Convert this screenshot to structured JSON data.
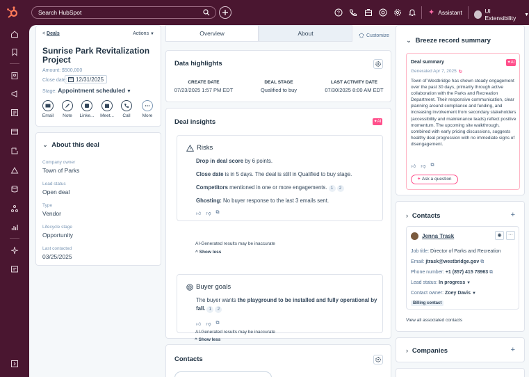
{
  "topbar": {
    "search_placeholder": "Search HubSpot",
    "assistant_label": "Assistant",
    "account_label": "UI Extensibility"
  },
  "record": {
    "back_label": "Deals",
    "actions_label": "Actions",
    "title": "Sunrise Park Revitalization Project",
    "amount": "Amount: $500,000",
    "close_date_label": "Close date:",
    "close_date": "12/31/2025",
    "stage_label": "Stage:",
    "stage": "Appointment scheduled",
    "actions": [
      "Email",
      "Note",
      "Linke...",
      "Meet...",
      "Call",
      "More"
    ]
  },
  "about": {
    "heading": "About this deal",
    "props": [
      {
        "label": "Company owner",
        "value": "Town of Parks"
      },
      {
        "label": "Lead status",
        "value": "Open deal"
      },
      {
        "label": "Type",
        "value": "Vendor"
      },
      {
        "label": "Lifecycle stage",
        "value": "Opportunity"
      },
      {
        "label": "Last contacted",
        "value": "03/25/2025"
      }
    ]
  },
  "tabs": {
    "overview": "Overview",
    "about": "About",
    "customize": "Customize"
  },
  "highlights": {
    "title": "Data highlights",
    "cols": [
      {
        "label": "CREATE DATE",
        "value": "07/23/2025 1:57 PM EDT"
      },
      {
        "label": "DEAL STAGE",
        "value": "Qualified to buy"
      },
      {
        "label": "LAST ACTIVITY DATE",
        "value": "07/30/2025 8:00 AM EDT"
      }
    ]
  },
  "insights": {
    "title": "Deal insights",
    "ai_badge": "AI",
    "risks": {
      "title": "Risks",
      "l1_b": "Drop in deal score",
      "l1_t": " by 6 points.",
      "l2_b": "Close date",
      "l2_t": " is in 5 days. The deal is still in Qualified to buy stage.",
      "l3_b": "Competitors",
      "l3_t": " mentioned in one or more engagements.",
      "l4_b": "Ghosting:",
      "l4_t": " No buyer response to the last 3 emails sent.",
      "refs": [
        "1",
        "2"
      ],
      "disclaimer": "AI-Generated results may be inaccurate",
      "show_less": "Show less"
    },
    "goals": {
      "title": "Buyer goals",
      "pre": "The buyer wants ",
      "bold": "the playground to be installed and fully operational by fall.",
      "refs": [
        "1",
        "2"
      ],
      "disclaimer": "AI-Generated results may be inaccurate",
      "show_less": "Show less"
    }
  },
  "contacts_mid": {
    "title": "Contacts"
  },
  "breeze": {
    "title": "Breeze record summary",
    "summary_label": "Deal summary",
    "generated": "Generated Apr 7, 2025",
    "ai_badge": "AI",
    "body": "Town of Westbridge has shown steady engagement over the past 30 days, primarily through active collaboration with the Parks and Recreation Department. Their responsive communication, clear planning around compliance and funding, and increasing involvement from secondary stakeholders (accessibility and maintenance leads) reflect positive momentum. The upcoming site walkthrough, combined with early pricing discussions, suggests healthy deal progression with no immediate signs of disengagement.",
    "ask": "Ask a question"
  },
  "contacts_right": {
    "title": "Contacts",
    "name": "Jenna Trask",
    "job_label": "Job title:",
    "job": "Director of Parks and Recreation",
    "email_label": "Email:",
    "email": "jtrask@westbridge.gov",
    "phone_label": "Phone number:",
    "phone": "+1 (857) 415 78963",
    "lead_label": "Lead status:",
    "lead": "In progress",
    "owner_label": "Contact owner:",
    "owner": "Zoey Davis",
    "tag": "Billing contact",
    "view_all": "View all associated contacts"
  },
  "companies": {
    "title": "Companies"
  },
  "colors": {
    "brand": "#4a1630",
    "accent": "#ff7a59",
    "ai": "#ff4f8b"
  }
}
